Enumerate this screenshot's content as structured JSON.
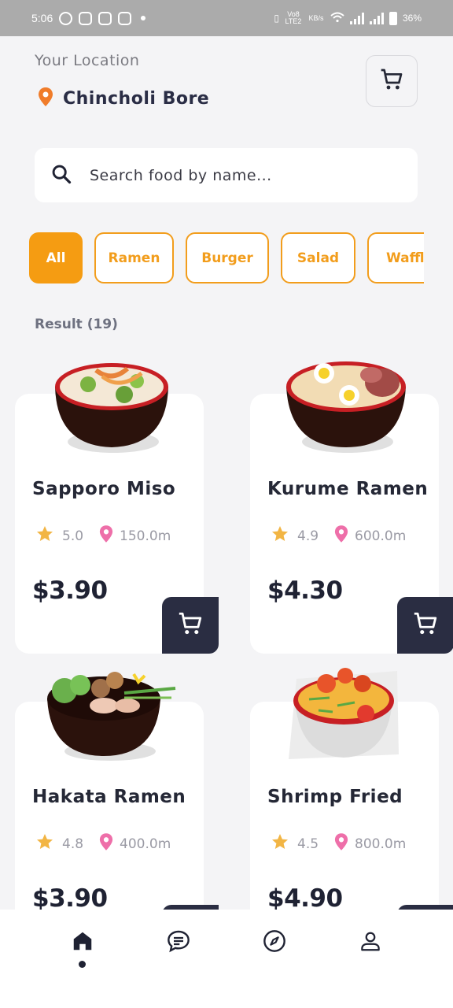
{
  "status_bar": {
    "time": "5:06",
    "signal_label": "Vo8 LTE2",
    "speed_label": "KB/s",
    "battery": "36%"
  },
  "location": {
    "label": "Your Location",
    "name": "Chincholi Bore"
  },
  "search": {
    "placeholder": "Search food by name..."
  },
  "categories": [
    "All",
    "Ramen",
    "Burger",
    "Salad",
    "Waffle"
  ],
  "active_category": "All",
  "result": {
    "label": "Result (19)"
  },
  "foods": [
    {
      "name": "Sapporo Miso",
      "rating": "5.0",
      "distance": "150.0m",
      "price": "$3.90"
    },
    {
      "name": "Kurume Ramen",
      "rating": "4.9",
      "distance": "600.0m",
      "price": "$4.30"
    },
    {
      "name": "Hakata Ramen",
      "rating": "4.8",
      "distance": "400.0m",
      "price": "$3.90"
    },
    {
      "name": "Shrimp Fried",
      "rating": "4.5",
      "distance": "800.0m",
      "price": "$4.90"
    }
  ],
  "nav": {
    "items": [
      "home-icon",
      "chat-icon",
      "compass-icon",
      "profile-icon"
    ],
    "active": "home-icon"
  },
  "colors": {
    "accent": "#f59c12",
    "dark": "#2a2d42",
    "star": "#f2b544",
    "pin": "#ee6fa9",
    "location_pin": "#f07c2a"
  }
}
